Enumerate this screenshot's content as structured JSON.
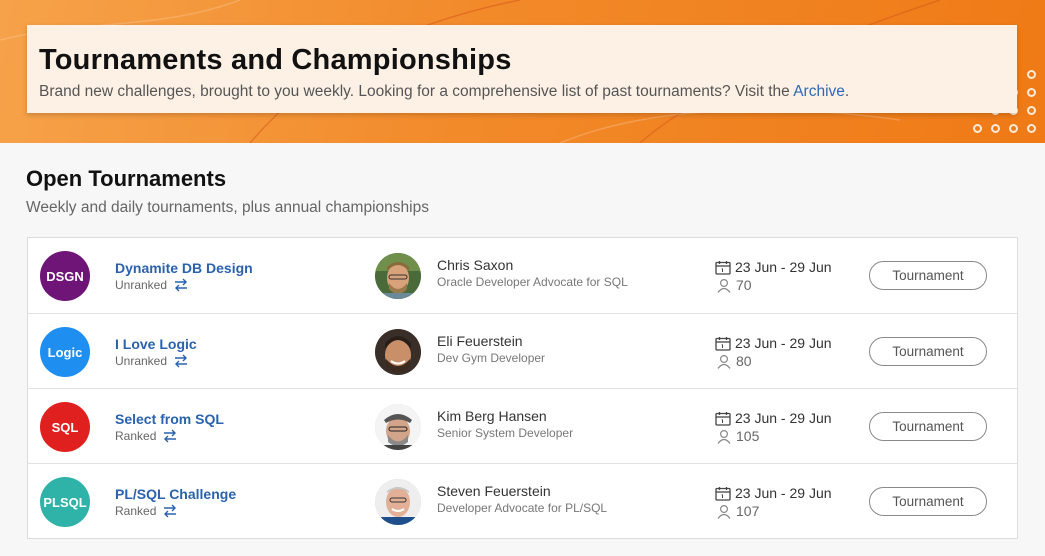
{
  "header": {
    "title": "Tournaments and Championships",
    "subtitle": "Brand new challenges, brought to you weekly. Looking for a comprehensive list of past tournaments? Visit the ",
    "archive_link": "Archive",
    "subtitle_end": "."
  },
  "section": {
    "title": "Open Tournaments",
    "subtitle": "Weekly and daily tournaments, plus annual championships"
  },
  "tournaments": [
    {
      "badge": "DSGN",
      "badge_color": "#6f1578",
      "name": "Dynamite DB Design",
      "rank": "Unranked",
      "host": "Chris Saxon",
      "role": "Oracle Developer Advocate for SQL",
      "dates": "23 Jun - 29 Jun",
      "players": "70",
      "button": "Tournament"
    },
    {
      "badge": "Logic",
      "badge_color": "#1e8ff0",
      "name": "I Love Logic",
      "rank": "Unranked",
      "host": "Eli Feuerstein",
      "role": "Dev Gym Developer",
      "dates": "23 Jun - 29 Jun",
      "players": "80",
      "button": "Tournament"
    },
    {
      "badge": "SQL",
      "badge_color": "#e0201f",
      "name": "Select from SQL",
      "rank": "Ranked",
      "host": "Kim Berg Hansen",
      "role": "Senior System Developer",
      "dates": "23 Jun - 29 Jun",
      "players": "105",
      "button": "Tournament"
    },
    {
      "badge": "PLSQL",
      "badge_color": "#2fb2a8",
      "name": "PL/SQL Challenge",
      "rank": "Ranked",
      "host": "Steven Feuerstein",
      "role": "Developer Advocate for PL/SQL",
      "dates": "23 Jun - 29 Jun",
      "players": "107",
      "button": "Tournament"
    }
  ],
  "colors": {
    "banner_orange": "#f28a2a",
    "link_blue": "#2a62ad"
  },
  "icons": {
    "rank": "swap-arrows-icon",
    "dates": "calendar-icon",
    "players": "user-icon"
  }
}
